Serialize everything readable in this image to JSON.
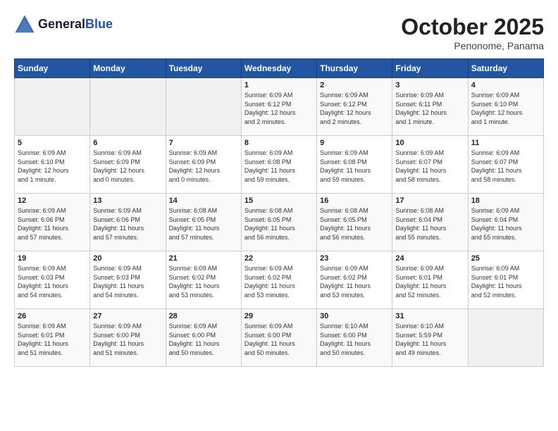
{
  "header": {
    "logo_line1": "General",
    "logo_line2": "Blue",
    "month": "October 2025",
    "location": "Penonome, Panama"
  },
  "days_of_week": [
    "Sunday",
    "Monday",
    "Tuesday",
    "Wednesday",
    "Thursday",
    "Friday",
    "Saturday"
  ],
  "weeks": [
    [
      {
        "day": "",
        "info": ""
      },
      {
        "day": "",
        "info": ""
      },
      {
        "day": "",
        "info": ""
      },
      {
        "day": "1",
        "info": "Sunrise: 6:09 AM\nSunset: 6:12 PM\nDaylight: 12 hours\nand 2 minutes."
      },
      {
        "day": "2",
        "info": "Sunrise: 6:09 AM\nSunset: 6:12 PM\nDaylight: 12 hours\nand 2 minutes."
      },
      {
        "day": "3",
        "info": "Sunrise: 6:09 AM\nSunset: 6:11 PM\nDaylight: 12 hours\nand 1 minute."
      },
      {
        "day": "4",
        "info": "Sunrise: 6:09 AM\nSunset: 6:10 PM\nDaylight: 12 hours\nand 1 minute."
      }
    ],
    [
      {
        "day": "5",
        "info": "Sunrise: 6:09 AM\nSunset: 6:10 PM\nDaylight: 12 hours\nand 1 minute."
      },
      {
        "day": "6",
        "info": "Sunrise: 6:09 AM\nSunset: 6:09 PM\nDaylight: 12 hours\nand 0 minutes."
      },
      {
        "day": "7",
        "info": "Sunrise: 6:09 AM\nSunset: 6:09 PM\nDaylight: 12 hours\nand 0 minutes."
      },
      {
        "day": "8",
        "info": "Sunrise: 6:09 AM\nSunset: 6:08 PM\nDaylight: 11 hours\nand 59 minutes."
      },
      {
        "day": "9",
        "info": "Sunrise: 6:09 AM\nSunset: 6:08 PM\nDaylight: 11 hours\nand 59 minutes."
      },
      {
        "day": "10",
        "info": "Sunrise: 6:09 AM\nSunset: 6:07 PM\nDaylight: 11 hours\nand 58 minutes."
      },
      {
        "day": "11",
        "info": "Sunrise: 6:09 AM\nSunset: 6:07 PM\nDaylight: 11 hours\nand 58 minutes."
      }
    ],
    [
      {
        "day": "12",
        "info": "Sunrise: 6:09 AM\nSunset: 6:06 PM\nDaylight: 11 hours\nand 57 minutes."
      },
      {
        "day": "13",
        "info": "Sunrise: 6:09 AM\nSunset: 6:06 PM\nDaylight: 11 hours\nand 57 minutes."
      },
      {
        "day": "14",
        "info": "Sunrise: 6:08 AM\nSunset: 6:05 PM\nDaylight: 11 hours\nand 57 minutes."
      },
      {
        "day": "15",
        "info": "Sunrise: 6:08 AM\nSunset: 6:05 PM\nDaylight: 11 hours\nand 56 minutes."
      },
      {
        "day": "16",
        "info": "Sunrise: 6:08 AM\nSunset: 6:05 PM\nDaylight: 11 hours\nand 56 minutes."
      },
      {
        "day": "17",
        "info": "Sunrise: 6:08 AM\nSunset: 6:04 PM\nDaylight: 11 hours\nand 55 minutes."
      },
      {
        "day": "18",
        "info": "Sunrise: 6:09 AM\nSunset: 6:04 PM\nDaylight: 11 hours\nand 55 minutes."
      }
    ],
    [
      {
        "day": "19",
        "info": "Sunrise: 6:09 AM\nSunset: 6:03 PM\nDaylight: 11 hours\nand 54 minutes."
      },
      {
        "day": "20",
        "info": "Sunrise: 6:09 AM\nSunset: 6:03 PM\nDaylight: 11 hours\nand 54 minutes."
      },
      {
        "day": "21",
        "info": "Sunrise: 6:09 AM\nSunset: 6:02 PM\nDaylight: 11 hours\nand 53 minutes."
      },
      {
        "day": "22",
        "info": "Sunrise: 6:09 AM\nSunset: 6:02 PM\nDaylight: 11 hours\nand 53 minutes."
      },
      {
        "day": "23",
        "info": "Sunrise: 6:09 AM\nSunset: 6:02 PM\nDaylight: 11 hours\nand 53 minutes."
      },
      {
        "day": "24",
        "info": "Sunrise: 6:09 AM\nSunset: 6:01 PM\nDaylight: 11 hours\nand 52 minutes."
      },
      {
        "day": "25",
        "info": "Sunrise: 6:09 AM\nSunset: 6:01 PM\nDaylight: 11 hours\nand 52 minutes."
      }
    ],
    [
      {
        "day": "26",
        "info": "Sunrise: 6:09 AM\nSunset: 6:01 PM\nDaylight: 11 hours\nand 51 minutes."
      },
      {
        "day": "27",
        "info": "Sunrise: 6:09 AM\nSunset: 6:00 PM\nDaylight: 11 hours\nand 51 minutes."
      },
      {
        "day": "28",
        "info": "Sunrise: 6:09 AM\nSunset: 6:00 PM\nDaylight: 11 hours\nand 50 minutes."
      },
      {
        "day": "29",
        "info": "Sunrise: 6:09 AM\nSunset: 6:00 PM\nDaylight: 11 hours\nand 50 minutes."
      },
      {
        "day": "30",
        "info": "Sunrise: 6:10 AM\nSunset: 6:00 PM\nDaylight: 11 hours\nand 50 minutes."
      },
      {
        "day": "31",
        "info": "Sunrise: 6:10 AM\nSunset: 5:59 PM\nDaylight: 11 hours\nand 49 minutes."
      },
      {
        "day": "",
        "info": ""
      }
    ]
  ]
}
